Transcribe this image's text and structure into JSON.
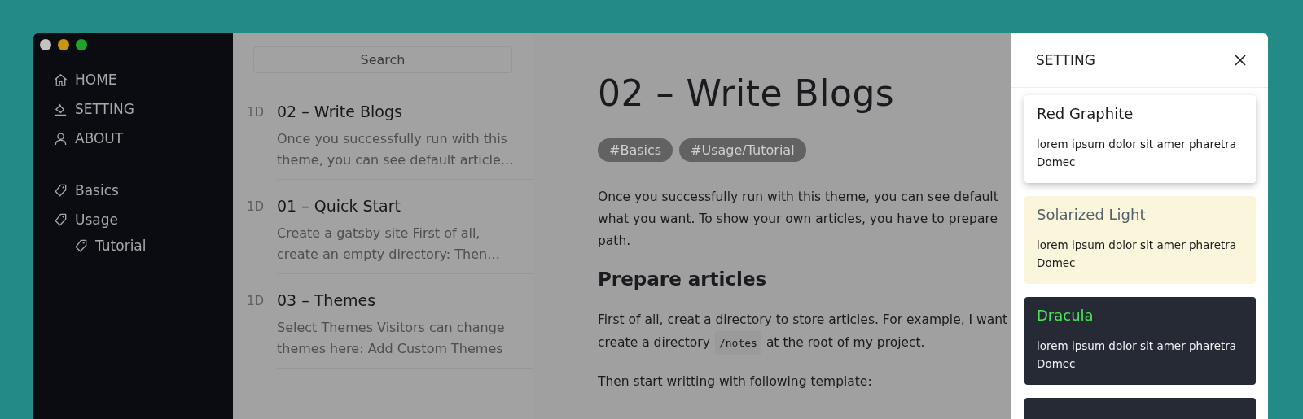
{
  "sidebar": {
    "nav": [
      {
        "label": "HOME",
        "kind": "home"
      },
      {
        "label": "SETTING",
        "kind": "brush"
      },
      {
        "label": "ABOUT",
        "kind": "user"
      }
    ],
    "tags": [
      {
        "label": "Basics"
      },
      {
        "label": "Usage",
        "children": [
          {
            "label": "Tutorial"
          }
        ]
      }
    ]
  },
  "article_list": {
    "search": {
      "placeholder": "Search"
    },
    "items": [
      {
        "age": "1D",
        "title": "02 – Write Blogs",
        "summary": "Once you successfully run with this theme, you can see default article…"
      },
      {
        "age": "1D",
        "title": "01 – Quick Start",
        "summary": "Create a gatsby site First of all, create an empty directory: Then…"
      },
      {
        "age": "1D",
        "title": "03 – Themes",
        "summary": "Select Themes Visitors can change themes here: Add Custom Themes"
      }
    ]
  },
  "article": {
    "title": "02 – Write Blogs",
    "tags": [
      "#Basics",
      "#Usage/Tutorial"
    ],
    "intro_lines": [
      "Once you successfully run with this theme, you can see default",
      "what you want. To show your own articles, you have to prepare",
      "path."
    ],
    "heading": "Prepare articles",
    "para_line_1": "First of all, creat a directory to store articles. For example, I want",
    "para_line_2": {
      "before": "create a directory",
      "code": "/notes",
      "after": "at the root of my project."
    },
    "para_line_3": "Then start writting with following template:"
  },
  "setting_panel": {
    "title": "SETTING",
    "themes": [
      {
        "name": "Red Graphite",
        "description": "lorem ipsum dolor sit amer pharetra Domec",
        "kind": "light",
        "selected": true
      },
      {
        "name": "Solarized Light",
        "description": "lorem ipsum dolor sit amer pharetra Domec",
        "kind": "solarized",
        "selected": false
      },
      {
        "name": "Dracula",
        "description": "lorem ipsum dolor sit amer pharetra Domec",
        "kind": "dark",
        "selected": false
      },
      {
        "kind": "dark",
        "selected": false
      }
    ]
  }
}
